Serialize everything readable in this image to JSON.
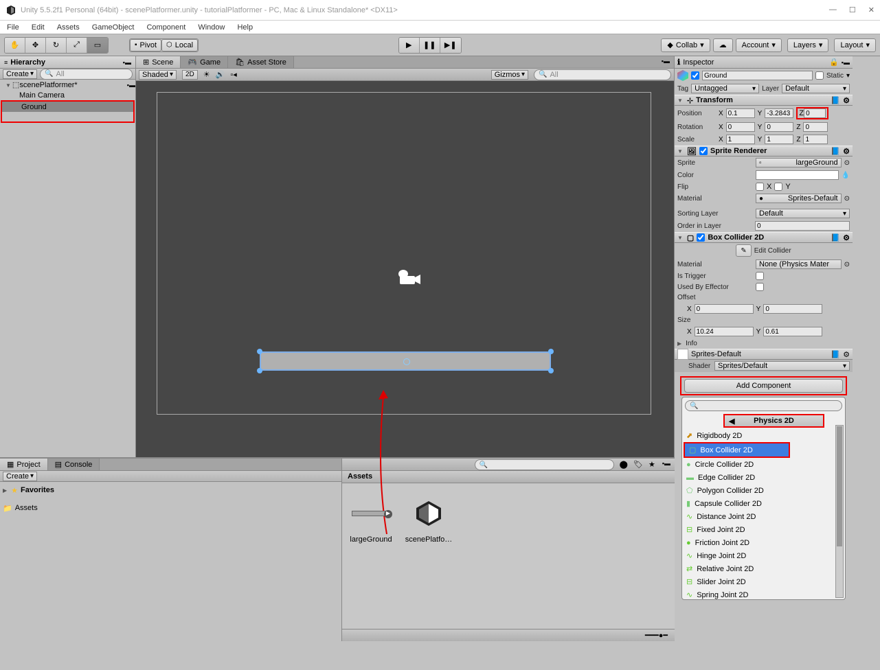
{
  "title": "Unity 5.5.2f1 Personal (64bit) - scenePlatformer.unity - tutorialPlatformer - PC, Mac & Linux Standalone* <DX11>",
  "menu": [
    "File",
    "Edit",
    "Assets",
    "GameObject",
    "Component",
    "Window",
    "Help"
  ],
  "toolbar": {
    "pivot": "Pivot",
    "local": "Local",
    "collab": "Collab",
    "account": "Account",
    "layers": "Layers",
    "layout": "Layout"
  },
  "hierarchy": {
    "tabLabel": "Hierarchy",
    "create": "Create",
    "searchPlaceholder": "All",
    "scene": "scenePlatformer*",
    "items": [
      "Main Camera",
      "Ground"
    ]
  },
  "sceneTabs": {
    "scene": "Scene",
    "game": "Game",
    "asset": "Asset Store"
  },
  "sceneBar": {
    "shaded": "Shaded",
    "mode2d": "2D",
    "gizmos": "Gizmos",
    "searchPlaceholder": "All"
  },
  "project": {
    "tabProject": "Project",
    "tabConsole": "Console",
    "create": "Create",
    "favorites": "Favorites",
    "assets": "Assets"
  },
  "assetsPanel": {
    "header": "Assets",
    "items": [
      "largeGround",
      "scenePlatfo…"
    ]
  },
  "inspector": {
    "tab": "Inspector",
    "name": "Ground",
    "static": "Static",
    "tagLabel": "Tag",
    "tagValue": "Untagged",
    "layerLabel": "Layer",
    "layerValue": "Default",
    "transform": {
      "title": "Transform",
      "position": "Position",
      "rotation": "Rotation",
      "scale": "Scale",
      "px": "0.1",
      "py": "-3.2843",
      "pz": "0",
      "rx": "0",
      "ry": "0",
      "rz": "0",
      "sx": "1",
      "sy": "1",
      "sz": "1"
    },
    "spriteRenderer": {
      "title": "Sprite Renderer",
      "spriteLabel": "Sprite",
      "spriteValue": "largeGround",
      "colorLabel": "Color",
      "flipLabel": "Flip",
      "flipX": "X",
      "flipY": "Y",
      "materialLabel": "Material",
      "materialValue": "Sprites-Default",
      "sortingLayerLabel": "Sorting Layer",
      "sortingLayerValue": "Default",
      "orderLabel": "Order in Layer",
      "orderValue": "0"
    },
    "boxCollider": {
      "title": "Box Collider 2D",
      "editCollider": "Edit Collider",
      "materialLabel": "Material",
      "materialValue": "None (Physics Mater",
      "isTriggerLabel": "Is Trigger",
      "usedByEffectorLabel": "Used By Effector",
      "offsetLabel": "Offset",
      "ox": "0",
      "oy": "0",
      "sizeLabel": "Size",
      "sx": "10.24",
      "sy": "0.61",
      "infoLabel": "Info"
    },
    "materialPreview": {
      "name": "Sprites-Default",
      "shaderLabel": "Shader",
      "shaderValue": "Sprites/Default"
    },
    "addComponent": "Add Component"
  },
  "componentMenu": {
    "searchPlaceholder": "",
    "header": "Physics 2D",
    "items": [
      "Rigidbody 2D",
      "Box Collider 2D",
      "Circle Collider 2D",
      "Edge Collider 2D",
      "Polygon Collider 2D",
      "Capsule Collider 2D",
      "Distance Joint 2D",
      "Fixed Joint 2D",
      "Friction Joint 2D",
      "Hinge Joint 2D",
      "Relative Joint 2D",
      "Slider Joint 2D",
      "Spring Joint 2D"
    ]
  }
}
